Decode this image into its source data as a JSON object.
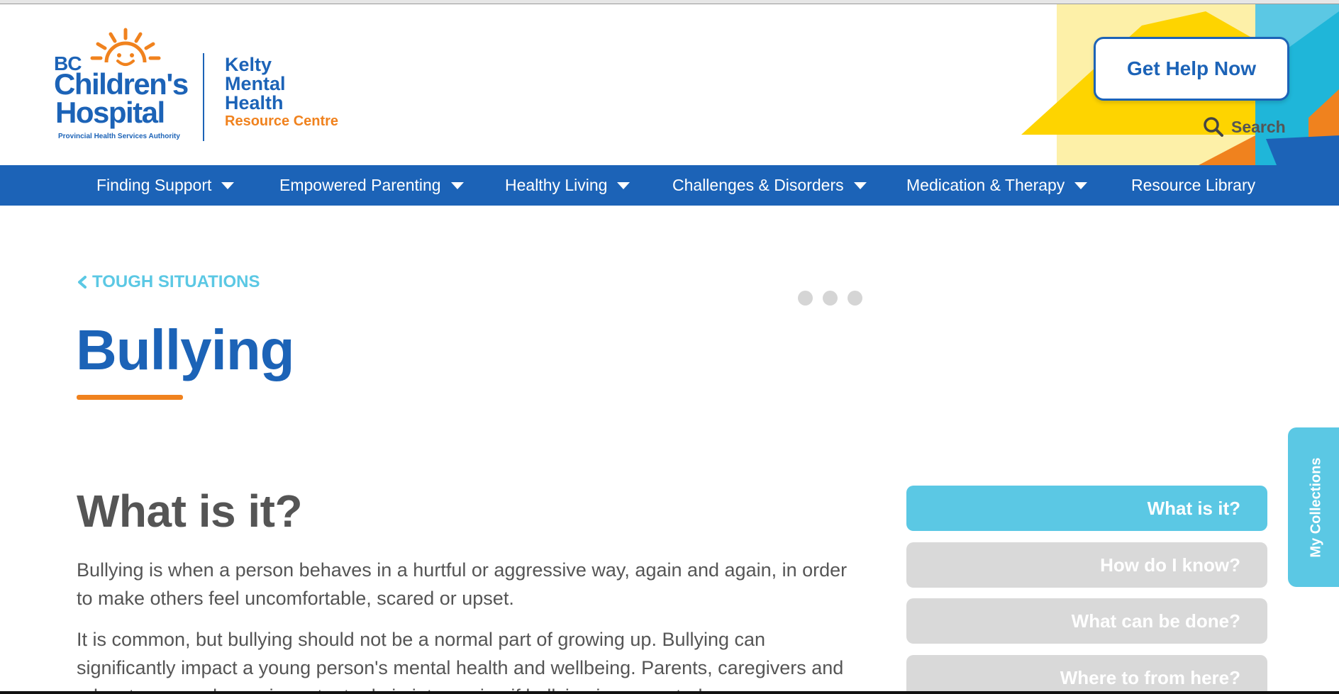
{
  "header": {
    "logo": {
      "bc": "BC",
      "childrens": "Children's",
      "hospital": "Hospital",
      "phsa": "Provincial Health Services Authority",
      "kelty_lines": [
        "Kelty",
        "Mental",
        "Health"
      ],
      "resource_centre": "Resource Centre"
    },
    "help_button": "Get Help Now",
    "search_label": "Search"
  },
  "nav": {
    "items": [
      {
        "label": "Finding Support",
        "has_dropdown": true
      },
      {
        "label": "Empowered Parenting",
        "has_dropdown": true
      },
      {
        "label": "Healthy Living",
        "has_dropdown": true
      },
      {
        "label": "Challenges & Disorders",
        "has_dropdown": true
      },
      {
        "label": "Medication & Therapy",
        "has_dropdown": true
      },
      {
        "label": "Resource Library",
        "has_dropdown": false
      }
    ]
  },
  "main": {
    "breadcrumb": "TOUGH SITUATIONS",
    "title": "Bullying",
    "section_title": "What is it?",
    "paragraphs": [
      "Bullying is when a person behaves in a hurtful or aggressive way, again and again, in order to make others feel uncomfortable, scared or upset.",
      "It is common, but bullying should not be a normal part of growing up. Bullying can significantly impact a young person's mental health and wellbeing. Parents, caregivers and educators can play an important role in intervening if bullying is suspected."
    ]
  },
  "toc": {
    "items": [
      {
        "label": "What is it?",
        "active": true
      },
      {
        "label": "How do I know?",
        "active": false
      },
      {
        "label": "What can be done?",
        "active": false
      },
      {
        "label": "Where to from here?",
        "active": false
      }
    ]
  },
  "collections_tab": "My Collections",
  "colors": {
    "brand_blue": "#1c63b7",
    "accent_orange": "#f0821e",
    "accent_cyan": "#5bc8e4",
    "inactive_gray": "#d9d9d9",
    "text_gray": "#555555"
  },
  "icons": [
    "sun-logo-icon",
    "search-icon",
    "chevron-left-icon",
    "chevron-down-icon"
  ]
}
